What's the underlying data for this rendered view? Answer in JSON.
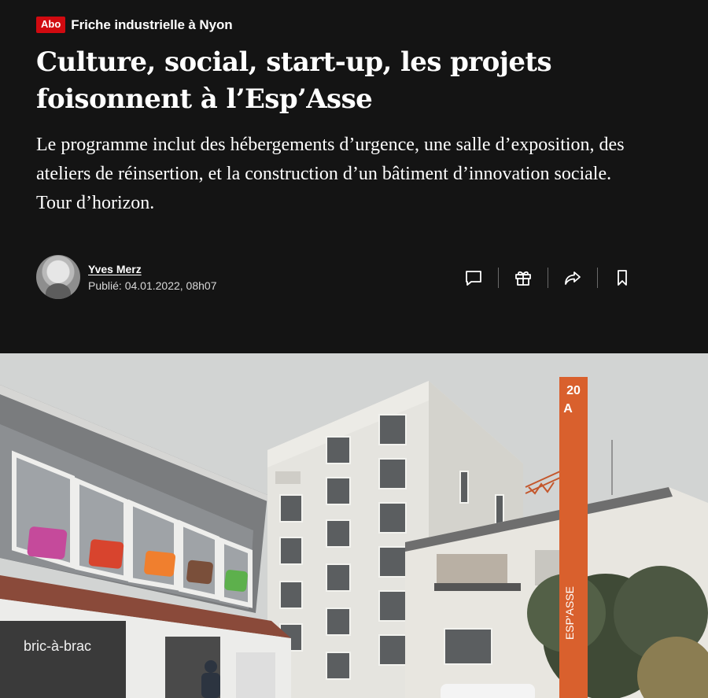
{
  "article": {
    "abo_label": "Abo",
    "kicker": "Friche industrielle à Nyon",
    "title": "Culture, social, start-up, les projets foisonnent à l’Esp’Asse",
    "lead": "Le programme inclut des hébergements d’urgence, une salle d’exposition, des ateliers de réinsertion, et la construction d’un bâtiment d’innovation sociale. Tour d’horizon.",
    "author": "Yves Merz",
    "published_prefix": "Publié:",
    "published_date": "04.01.2022, 08h07"
  },
  "actions": [
    {
      "icon": "comment-icon"
    },
    {
      "icon": "gift-icon"
    },
    {
      "icon": "share-icon"
    },
    {
      "icon": "bookmark-icon"
    }
  ],
  "hero": {
    "sign_number": "20",
    "sign_letter": "A",
    "sign_name": "ESP'ASSE",
    "shop_sign": "bric-à-brac"
  },
  "colors": {
    "background": "#141414",
    "abo_badge": "#d10a10",
    "sign_orange": "#d9602d"
  }
}
